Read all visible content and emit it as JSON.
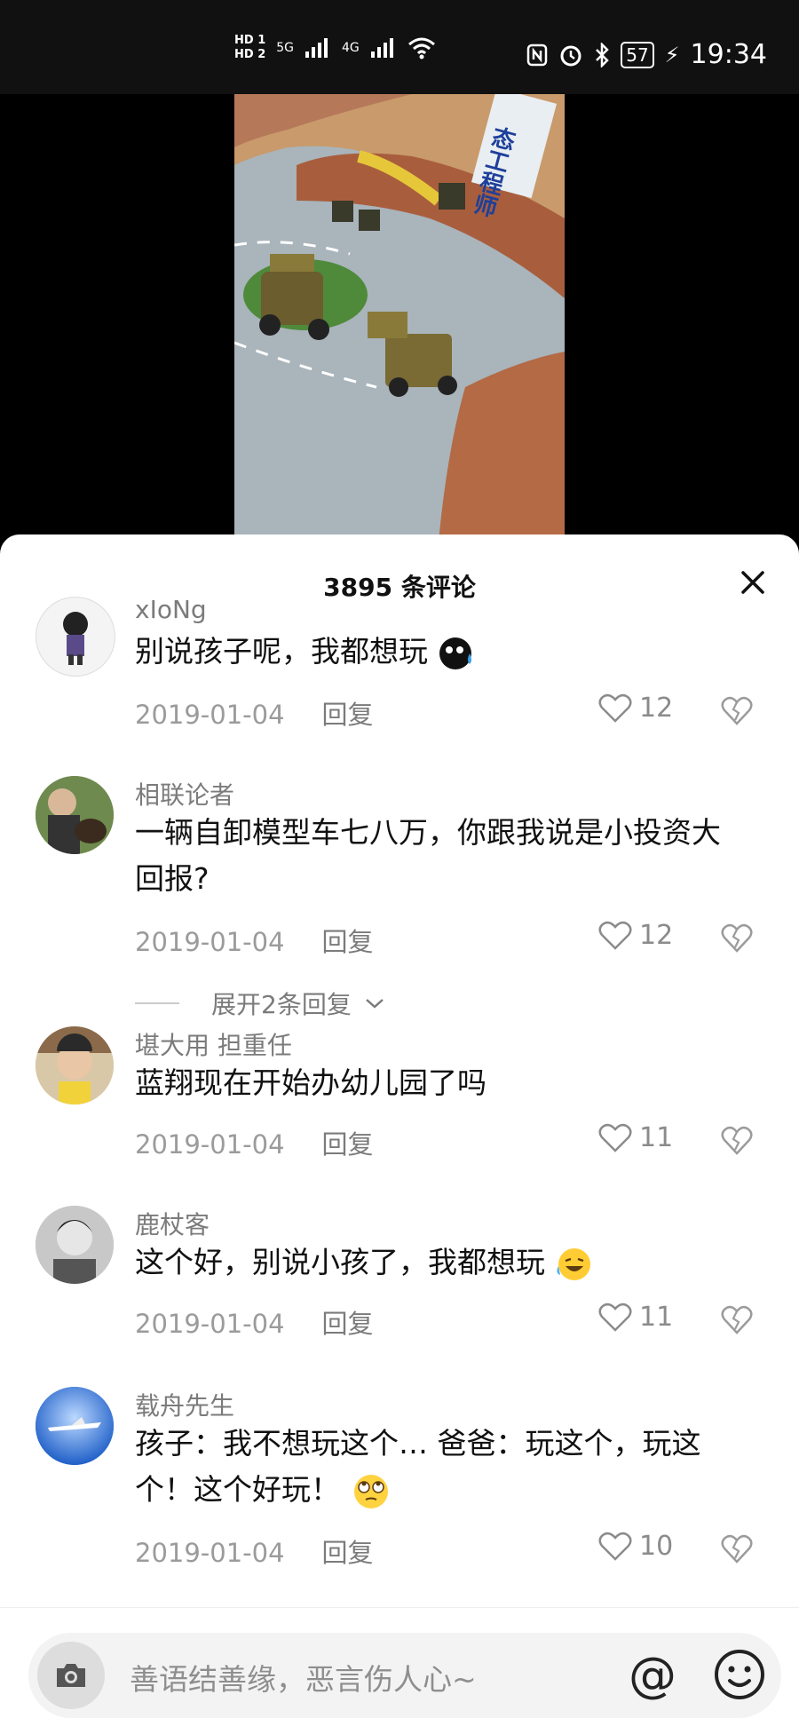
{
  "status_bar": {
    "hd1": "HD 1",
    "hd2": "HD 2",
    "net1": "5G",
    "net2": "4G",
    "battery": "57",
    "time": "19:34"
  },
  "video": {
    "banner_text": "态工程师"
  },
  "sheet": {
    "title": "3895 条评论",
    "reply_label": "回复"
  },
  "comments": [
    {
      "user": "xIoNg",
      "text": "别说孩子呢，我都想玩",
      "date": "2019-01-04",
      "likes": "12"
    },
    {
      "user": "相联论者",
      "text": "一辆自卸模型车七八万，你跟我说是小投资大回报?",
      "date": "2019-01-04",
      "likes": "12",
      "expand": "展开2条回复"
    },
    {
      "user": "堪大用 担重任",
      "text": "蓝翔现在开始办幼儿园了吗",
      "date": "2019-01-04",
      "likes": "11"
    },
    {
      "user": "鹿杖客",
      "text": "这个好，别说小孩了，我都想玩",
      "date": "2019-01-04",
      "likes": "11"
    },
    {
      "user": "载舟先生",
      "text": "孩子：我不想玩这个… 爸爸：玩这个，玩这个！这个好玩！",
      "date": "2019-01-04",
      "likes": "10"
    }
  ],
  "input_bar": {
    "placeholder": "善语结善缘，恶言伤人心~",
    "at_symbol": "@"
  },
  "icons": {
    "camera": "camera-icon",
    "emoji": "emoji-icon",
    "close": "close-icon",
    "like": "heart-icon",
    "dislike": "broken-heart-icon"
  }
}
